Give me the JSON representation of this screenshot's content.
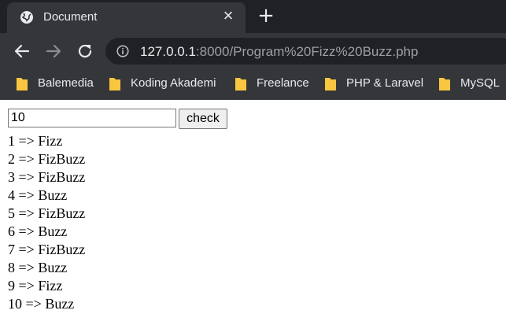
{
  "browser": {
    "tab": {
      "title": "Document"
    },
    "address": {
      "host": "127.0.0.1",
      "rest": ":8000/Program%20Fizz%20Buzz.php"
    },
    "bookmarks": [
      {
        "label": "Balemedia"
      },
      {
        "label": "Koding Akademi"
      },
      {
        "label": "Freelance"
      },
      {
        "label": "PHP & Laravel"
      },
      {
        "label": "MySQL"
      }
    ],
    "colors": {
      "frame": "#202124",
      "toolbar": "#35363a",
      "folder": "#f9c642",
      "text": "#e8eaed"
    }
  },
  "page": {
    "input_value": "10",
    "check_label": "check",
    "results": [
      {
        "n": "1",
        "arrow": "=>",
        "word": "Fizz"
      },
      {
        "n": "2",
        "arrow": "=>",
        "word": "FizBuzz"
      },
      {
        "n": "3",
        "arrow": "=>",
        "word": "FizBuzz"
      },
      {
        "n": "4",
        "arrow": "=>",
        "word": "Buzz"
      },
      {
        "n": "5",
        "arrow": "=>",
        "word": "FizBuzz"
      },
      {
        "n": "6",
        "arrow": "=>",
        "word": "Buzz"
      },
      {
        "n": "7",
        "arrow": "=>",
        "word": "FizBuzz"
      },
      {
        "n": "8",
        "arrow": "=>",
        "word": "Buzz"
      },
      {
        "n": "9",
        "arrow": "=>",
        "word": "Fizz"
      },
      {
        "n": "10",
        "arrow": "=>",
        "word": "Buzz"
      }
    ]
  }
}
